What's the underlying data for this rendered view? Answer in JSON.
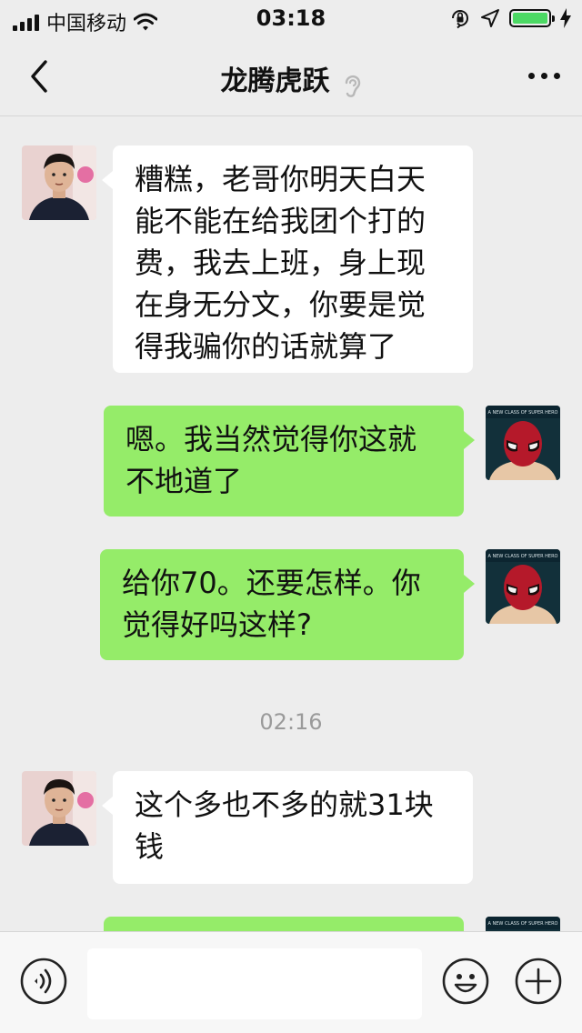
{
  "status_bar": {
    "carrier": "中国移动",
    "time": "03:18"
  },
  "nav": {
    "title": "龙腾虎跃"
  },
  "messages": [
    {
      "side": "left",
      "text": "糟糕，老哥你明天白天能不能在给我团个打的费，我去上班，身上现在身无分文，你要是觉得我骗你的话就算了",
      "lines": [
        "糟糕，老哥你明天白天",
        "能不能在给我团个打的",
        "费，我去上班，身上现",
        "在身无分文，你要是觉",
        "得我骗你的话就算了"
      ]
    },
    {
      "side": "right",
      "text": "嗯。我当然觉得你这就不地道了",
      "lines": [
        "嗯。我当然觉得你这就",
        "不地道了"
      ]
    },
    {
      "side": "right",
      "text": "给你70。还要怎样。你觉得好吗这样?",
      "lines": [
        "给你70。还要怎样。你",
        "觉得好吗这样?"
      ]
    },
    {
      "side": "left",
      "text": "这个多也不多的就31块钱",
      "lines": [
        "这个多也不多的就31块",
        "钱"
      ]
    }
  ],
  "timestamp": "02:16",
  "avatar_badge": "A NEW CLASS OF SUPER HERO",
  "input": {
    "value": ""
  },
  "colors": {
    "background": "#ededed",
    "bubble_left": "#ffffff",
    "bubble_right": "#95ec69",
    "battery": "#4cd964"
  },
  "icons": [
    "signal-icon",
    "wifi-icon",
    "orientation-lock-icon",
    "location-icon",
    "battery-icon",
    "charging-icon",
    "back-chevron-icon",
    "ear-icon",
    "more-icon",
    "voice-icon",
    "emoji-icon",
    "plus-icon"
  ]
}
